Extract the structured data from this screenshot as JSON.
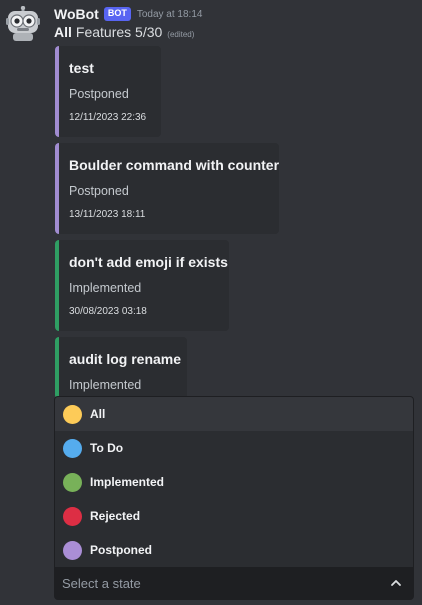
{
  "message": {
    "author": "WoBot",
    "bot_tag": "BOT",
    "timestamp": "Today at 18:14",
    "title_bold": "All",
    "title_rest": "Features 5/30",
    "edited": "(edited)"
  },
  "embeds": [
    {
      "title": "test",
      "status": "Postponed",
      "date": "12/11/2023 22:36",
      "color": "#a18cd1"
    },
    {
      "title": "Boulder command with counter",
      "status": "Postponed",
      "date": "13/11/2023 18:11",
      "color": "#a18cd1"
    },
    {
      "title": "don't add emoji if exists",
      "status": "Implemented",
      "date": "30/08/2023 03:18",
      "color": "#2f9e63"
    },
    {
      "title": "audit log rename",
      "status": "Implemented",
      "date": "",
      "color": "#2f9e63"
    }
  ],
  "menu": {
    "options": [
      {
        "label": "All",
        "color": "#fdcb58"
      },
      {
        "label": "To Do",
        "color": "#55acee"
      },
      {
        "label": "Implemented",
        "color": "#78b159"
      },
      {
        "label": "Rejected",
        "color": "#dd2e44"
      },
      {
        "label": "Postponed",
        "color": "#aa8ed6"
      }
    ],
    "placeholder": "Select a state"
  }
}
